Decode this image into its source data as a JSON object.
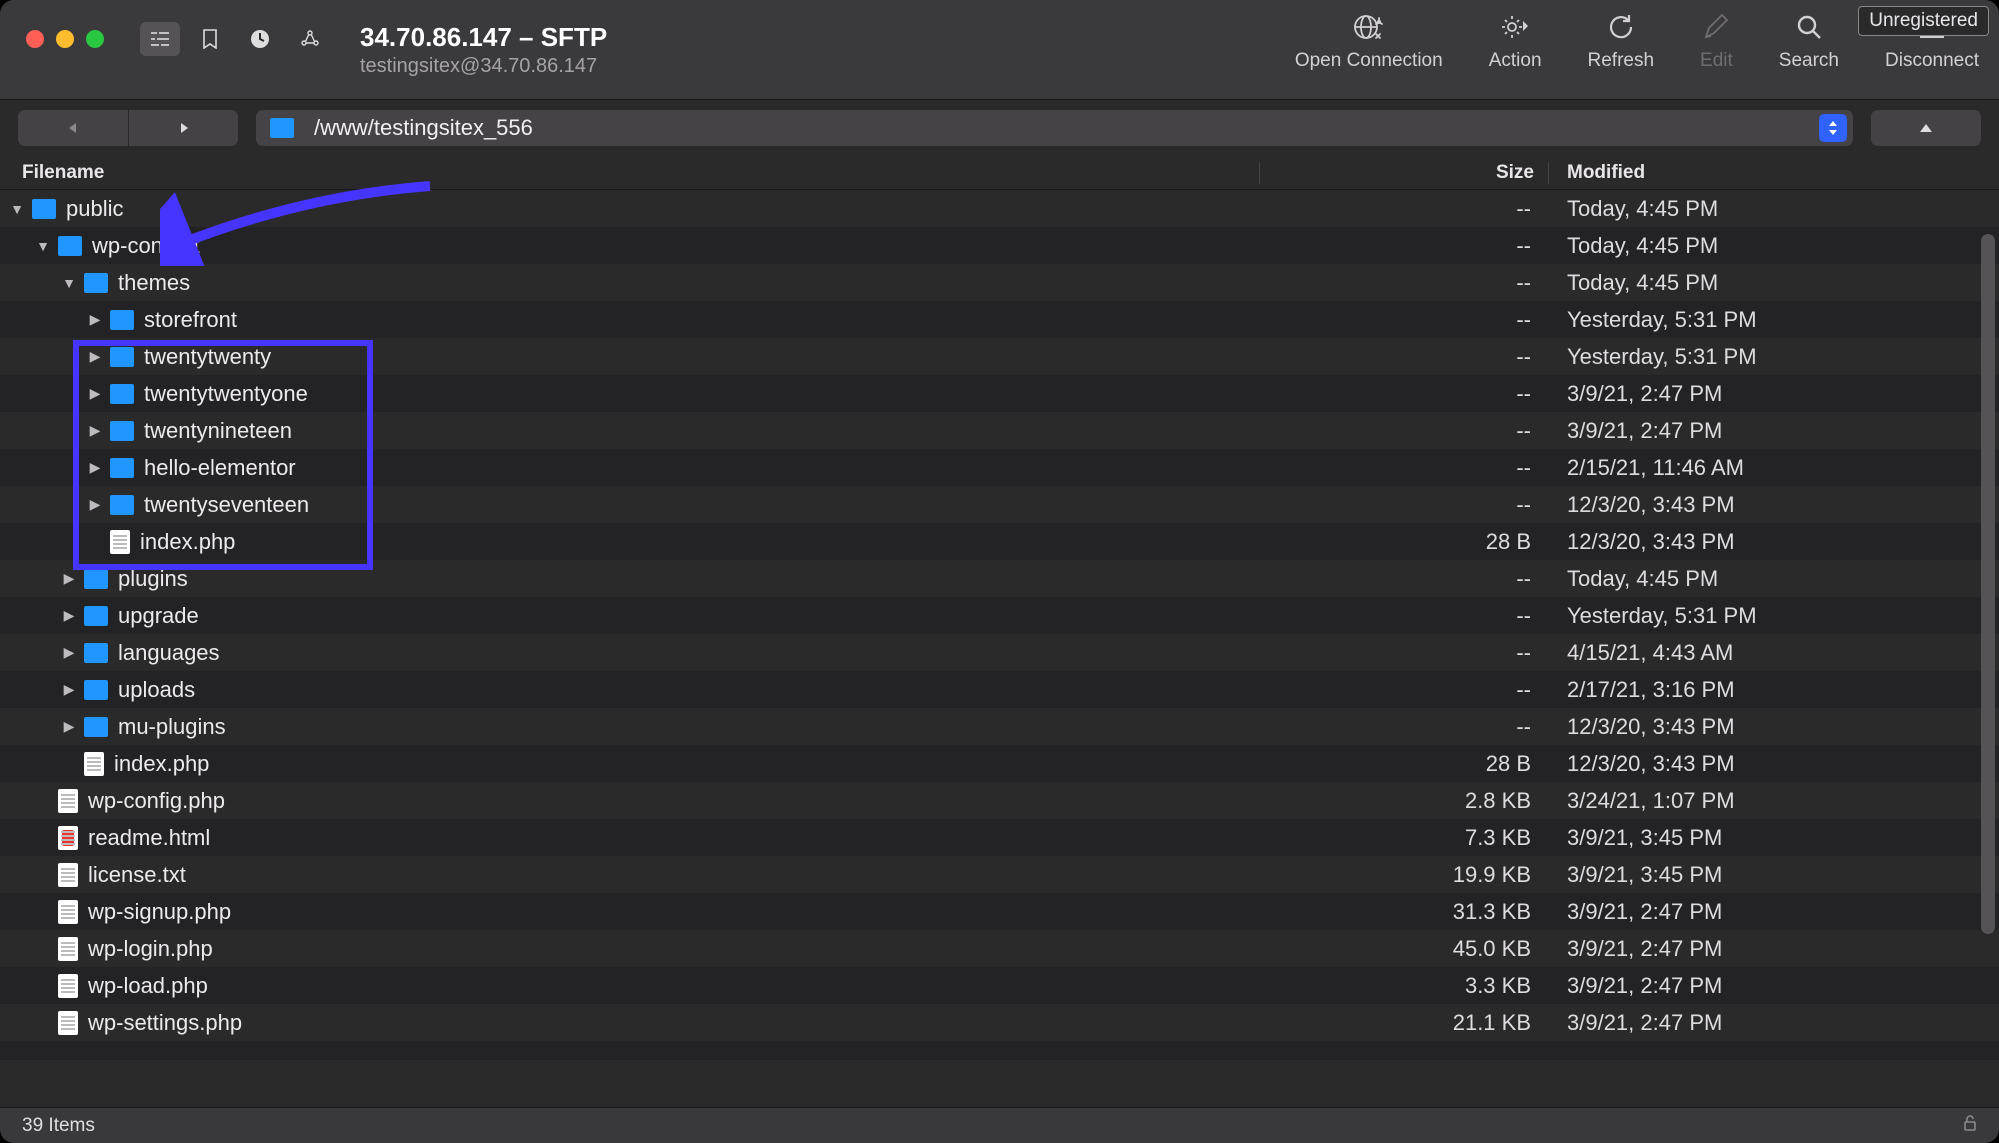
{
  "window": {
    "title": "34.70.86.147 – SFTP",
    "subtitle": "testingsitex@34.70.86.147",
    "unregistered_label": "Unregistered"
  },
  "main_toolbar": [
    {
      "id": "open-connection",
      "label": "Open Connection",
      "disabled": false
    },
    {
      "id": "action",
      "label": "Action",
      "disabled": false
    },
    {
      "id": "refresh",
      "label": "Refresh",
      "disabled": false
    },
    {
      "id": "edit",
      "label": "Edit",
      "disabled": true
    },
    {
      "id": "search",
      "label": "Search",
      "disabled": false
    },
    {
      "id": "disconnect",
      "label": "Disconnect",
      "disabled": false
    }
  ],
  "path": "/www/testingsitex_556",
  "columns": {
    "name": "Filename",
    "size": "Size",
    "modified": "Modified"
  },
  "rows": [
    {
      "depth": 0,
      "kind": "folder",
      "expand": "open",
      "name": "public",
      "size": "--",
      "modified": "Today, 4:45 PM"
    },
    {
      "depth": 1,
      "kind": "folder",
      "expand": "open",
      "name": "wp-content",
      "size": "--",
      "modified": "Today, 4:45 PM"
    },
    {
      "depth": 2,
      "kind": "folder",
      "expand": "open",
      "name": "themes",
      "size": "--",
      "modified": "Today, 4:45 PM"
    },
    {
      "depth": 3,
      "kind": "folder",
      "expand": "closed",
      "name": "storefront",
      "size": "--",
      "modified": "Yesterday, 5:31 PM"
    },
    {
      "depth": 3,
      "kind": "folder",
      "expand": "closed",
      "name": "twentytwenty",
      "size": "--",
      "modified": "Yesterday, 5:31 PM"
    },
    {
      "depth": 3,
      "kind": "folder",
      "expand": "closed",
      "name": "twentytwentyone",
      "size": "--",
      "modified": "3/9/21, 2:47 PM"
    },
    {
      "depth": 3,
      "kind": "folder",
      "expand": "closed",
      "name": "twentynineteen",
      "size": "--",
      "modified": "3/9/21, 2:47 PM"
    },
    {
      "depth": 3,
      "kind": "folder",
      "expand": "closed",
      "name": "hello-elementor",
      "size": "--",
      "modified": "2/15/21, 11:46 AM"
    },
    {
      "depth": 3,
      "kind": "folder",
      "expand": "closed",
      "name": "twentyseventeen",
      "size": "--",
      "modified": "12/3/20, 3:43 PM"
    },
    {
      "depth": 3,
      "kind": "file",
      "expand": "none",
      "name": "index.php",
      "size": "28 B",
      "modified": "12/3/20, 3:43 PM"
    },
    {
      "depth": 2,
      "kind": "folder",
      "expand": "closed",
      "name": "plugins",
      "size": "--",
      "modified": "Today, 4:45 PM"
    },
    {
      "depth": 2,
      "kind": "folder",
      "expand": "closed",
      "name": "upgrade",
      "size": "--",
      "modified": "Yesterday, 5:31 PM"
    },
    {
      "depth": 2,
      "kind": "folder",
      "expand": "closed",
      "name": "languages",
      "size": "--",
      "modified": "4/15/21, 4:43 AM"
    },
    {
      "depth": 2,
      "kind": "folder",
      "expand": "closed",
      "name": "uploads",
      "size": "--",
      "modified": "2/17/21, 3:16 PM"
    },
    {
      "depth": 2,
      "kind": "folder",
      "expand": "closed",
      "name": "mu-plugins",
      "size": "--",
      "modified": "12/3/20, 3:43 PM"
    },
    {
      "depth": 2,
      "kind": "file",
      "expand": "none",
      "name": "index.php",
      "size": "28 B",
      "modified": "12/3/20, 3:43 PM"
    },
    {
      "depth": 1,
      "kind": "file",
      "expand": "none",
      "name": "wp-config.php",
      "size": "2.8 KB",
      "modified": "3/24/21, 1:07 PM"
    },
    {
      "depth": 1,
      "kind": "file-red",
      "expand": "none",
      "name": "readme.html",
      "size": "7.3 KB",
      "modified": "3/9/21, 3:45 PM"
    },
    {
      "depth": 1,
      "kind": "file",
      "expand": "none",
      "name": "license.txt",
      "size": "19.9 KB",
      "modified": "3/9/21, 3:45 PM"
    },
    {
      "depth": 1,
      "kind": "file",
      "expand": "none",
      "name": "wp-signup.php",
      "size": "31.3 KB",
      "modified": "3/9/21, 2:47 PM"
    },
    {
      "depth": 1,
      "kind": "file",
      "expand": "none",
      "name": "wp-login.php",
      "size": "45.0 KB",
      "modified": "3/9/21, 2:47 PM"
    },
    {
      "depth": 1,
      "kind": "file",
      "expand": "none",
      "name": "wp-load.php",
      "size": "3.3 KB",
      "modified": "3/9/21, 2:47 PM"
    },
    {
      "depth": 1,
      "kind": "file",
      "expand": "none",
      "name": "wp-settings.php",
      "size": "21.1 KB",
      "modified": "3/9/21, 2:47 PM"
    }
  ],
  "status": {
    "items_label": "39 Items"
  }
}
